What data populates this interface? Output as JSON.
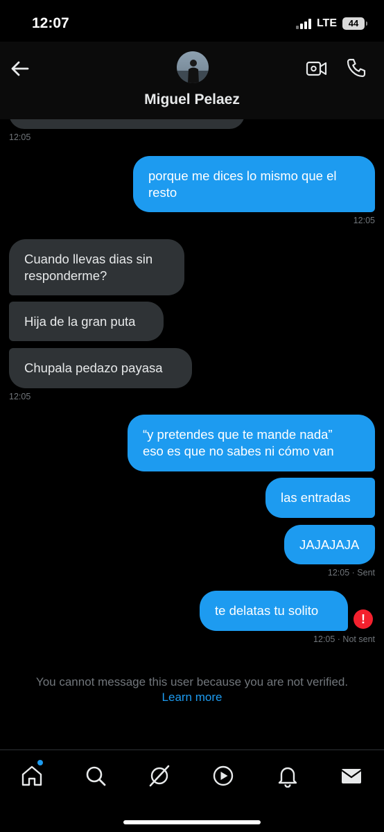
{
  "status_bar": {
    "time": "12:07",
    "network": "LTE",
    "battery": "44"
  },
  "header": {
    "contact_name": "Miguel Pelaez",
    "back_icon": "back-arrow-icon",
    "video_icon": "video-camera-icon",
    "call_icon": "phone-icon"
  },
  "messages": [
    {
      "direction": "in",
      "lines": [],
      "time": "12:05"
    },
    {
      "direction": "out",
      "lines": [
        "porque me dices lo mismo que el",
        "resto"
      ],
      "time": "12:05"
    },
    {
      "direction": "in",
      "lines": [
        "Cuando llevas dias sin",
        "responderme?"
      ]
    },
    {
      "direction": "in",
      "lines": [
        "Hija de la gran puta"
      ]
    },
    {
      "direction": "in",
      "lines": [
        "Chupala pedazo payasa"
      ],
      "time": "12:05"
    },
    {
      "direction": "out",
      "lines": [
        "“y pretendes que te mande nada”",
        "eso es que no sabes ni cómo van"
      ]
    },
    {
      "direction": "out",
      "lines": [
        "las entradas"
      ]
    },
    {
      "direction": "out",
      "lines": [
        "JAJAJAJA"
      ],
      "time": "12:05 · Sent"
    },
    {
      "direction": "out",
      "lines": [
        "te delatas tu solito"
      ],
      "time": "12:05 · Not sent",
      "error": true
    }
  ],
  "notice": {
    "text": "You cannot message this user because you are not verified.",
    "link": "Learn more"
  },
  "bottom_nav": {
    "items": [
      "home-icon",
      "search-icon",
      "grok-icon",
      "video-play-icon",
      "bell-icon",
      "mail-icon"
    ],
    "active": "home-icon",
    "home_has_notification_dot": true
  },
  "colors": {
    "background": "#000000",
    "incoming_bubble": "#2f3336",
    "outgoing_bubble": "#1d9bf0",
    "error": "#f4212e",
    "muted_text": "#71767b"
  }
}
